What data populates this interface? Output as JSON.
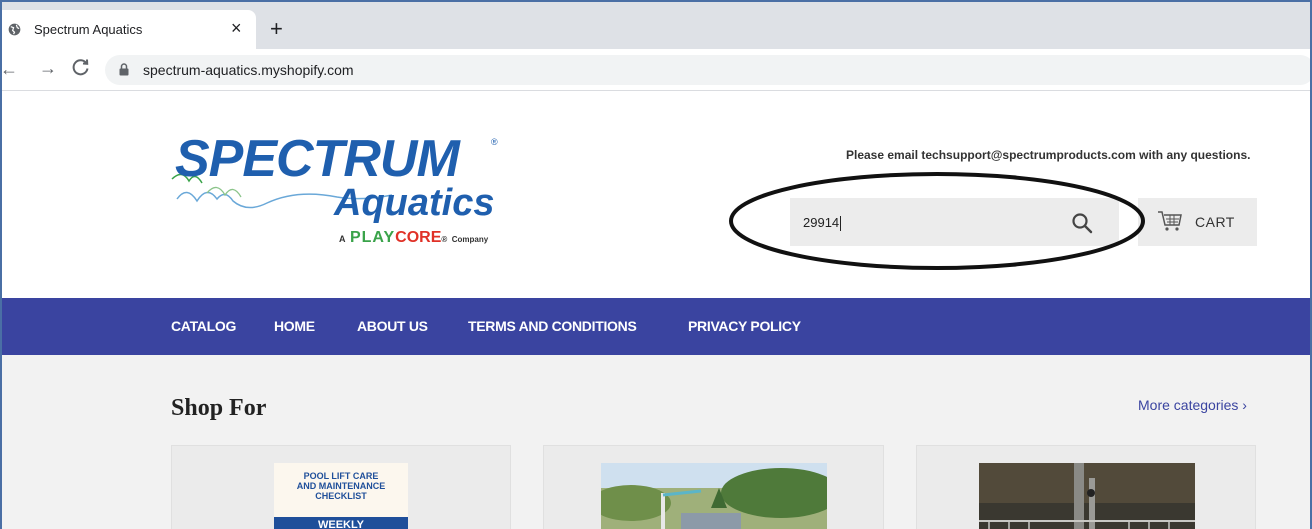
{
  "browser": {
    "tab_title": "Spectrum Aquatics",
    "tab_close": "×",
    "new_tab": "+",
    "back": "←",
    "forward": "→",
    "url": "spectrum-aquatics.myshopify.com"
  },
  "header": {
    "logo": {
      "wordmark": "SPECTRUM",
      "registered": "®",
      "sub": "Aquatics",
      "tagline_a": "A",
      "tagline_pl": "PLAY",
      "tagline_core": "CORE",
      "tagline_tm": "®",
      "tagline_company": "Company"
    },
    "support_text": "Please email techsupport@spectrumproducts.com with any questions.",
    "search": {
      "value": "29914",
      "icon": "search-icon"
    },
    "cart": {
      "label": "CART",
      "icon": "cart-icon"
    }
  },
  "nav": {
    "items": [
      "CATALOG",
      "HOME",
      "ABOUT US",
      "TERMS AND CONDITIONS",
      "PRIVACY POLICY"
    ]
  },
  "shop": {
    "title": "Shop For",
    "more_link": "More categories ›",
    "cards": [
      {
        "thumb_line1": "POOL LIFT CARE",
        "thumb_line2": "AND MAINTENANCE",
        "thumb_line3": "CHECKLIST",
        "thumb_band": "WEEKLY"
      },
      {},
      {}
    ]
  },
  "colors": {
    "brand_blue": "#1f5fae",
    "nav_bg": "#3a44a0",
    "playcore_green": "#3aa34a",
    "playcore_red": "#e03127"
  }
}
